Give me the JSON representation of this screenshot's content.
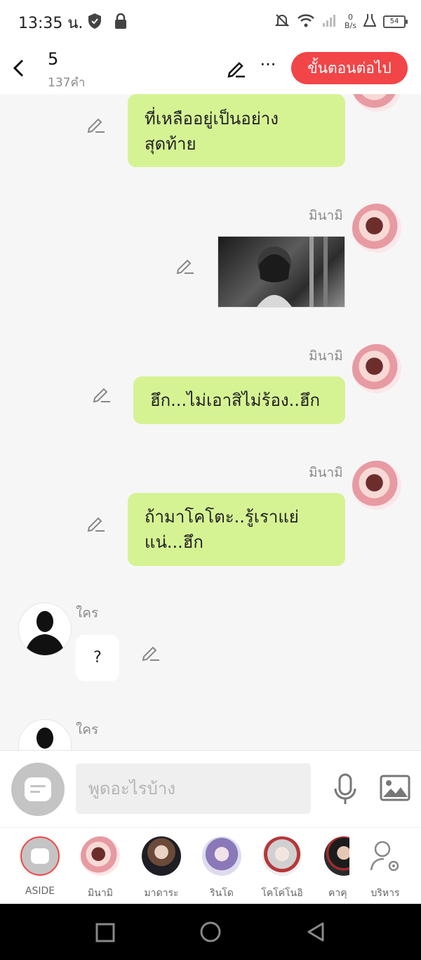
{
  "status_bar": {
    "time": "13:35 น.",
    "net_speed_value": "0",
    "net_speed_unit": "B/s",
    "battery": "54"
  },
  "header": {
    "title": "5",
    "subtitle": "137คำ",
    "next_label": "ขั้นตอนต่อไป"
  },
  "messages": [
    {
      "text": "ที่เหลืออยู่เป็นอย่าง\nสุดท้าย"
    },
    {
      "sender": "มินามิ"
    },
    {
      "sender": "มินามิ",
      "text": "ฮึก...ไม่เอาสิไม่ร้อง..ฮึก"
    },
    {
      "sender": "มินามิ",
      "text": "ถ้ามาโคโตะ..รู้เราแย่\nแน่...ฮึก"
    },
    {
      "sender": "ใคร",
      "text": "?"
    },
    {
      "sender": "ใคร"
    }
  ],
  "input": {
    "placeholder": "พูดอะไรบ้าง"
  },
  "characters": [
    {
      "label": "ASIDE"
    },
    {
      "label": "มินามิ"
    },
    {
      "label": "มาดาระ"
    },
    {
      "label": "รินโด"
    },
    {
      "label": "โคโค่โนอิ"
    },
    {
      "label": "คาคุ"
    },
    {
      "label": "บริหาร"
    }
  ],
  "colors": {
    "accent": "#f24548",
    "bubble": "#d6f394",
    "background": "#f6f6f6"
  }
}
